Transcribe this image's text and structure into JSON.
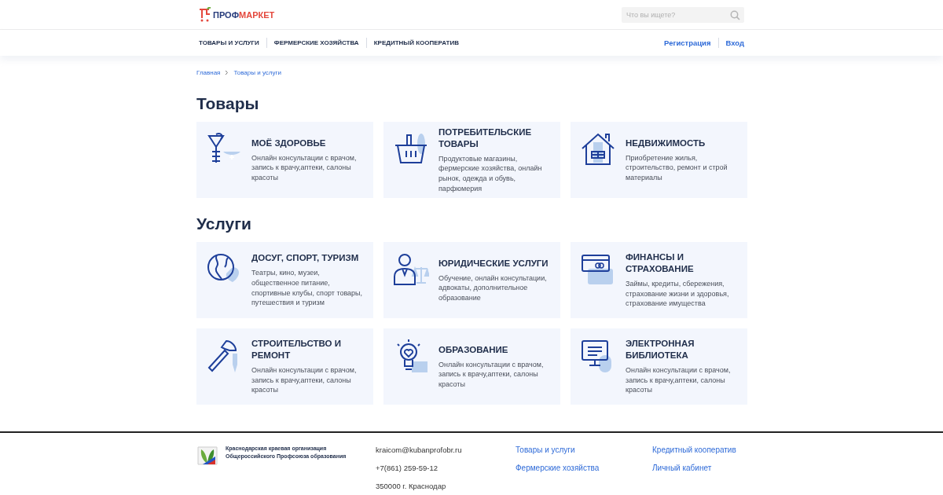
{
  "header": {
    "logo": {
      "part_1": "ПРОФ",
      "part_2": "МАРКЕТ"
    },
    "search": {
      "placeholder": "Что вы ищете?"
    }
  },
  "nav": {
    "items": [
      "ТОВАРЫ И УСЛУГИ",
      "ФЕРМЕРСКИЕ ХОЗЯЙСТВА",
      "КРЕДИТНЫЙ КООПЕРАТИВ"
    ],
    "auth": [
      "Регистрация",
      "Вход"
    ]
  },
  "breadcrumbs": [
    "Главная",
    "Товары и услуги"
  ],
  "sections": [
    {
      "title": "Товары",
      "cards": [
        {
          "title": "МОЁ ЗДОРОВЬЕ",
          "text": "Онлайн консультации с врачом, запись к врачу,аптеки, салоны красоты"
        },
        {
          "title": "ПОТРЕБИТЕЛЬСКИЕ ТОВАРЫ",
          "text": "Продуктовые магазины, фермерские хозяйства, онлайн рынок, одежда и обувь, парфюмерия"
        },
        {
          "title": "НЕДВИЖИМОСТЬ",
          "text": "Приобретение жилья, строительство, ремонт и строй материалы"
        }
      ]
    },
    {
      "title": "Услуги",
      "cards": [
        {
          "title": "ДОСУГ, СПОРТ, ТУРИЗМ",
          "text": "Театры, кино, музеи, общественное питание, спортивные клубы, спорт товары, путешествия и туризм"
        },
        {
          "title": "ЮРИДИЧЕСКИЕ УСЛУГИ",
          "text": "Обучение, онлайн консультации, адвокаты, дополнительное образование"
        },
        {
          "title": "ФИНАНСЫ И СТРАХОВАНИЕ",
          "text": "Займы, кредиты, сбережения, страхование жизни и здоровья, страхование имущества"
        },
        {
          "title": "СТРОИТЕЛЬСТВО И РЕМОНТ",
          "text": "Онлайн консультации с врачом, запись к врачу,аптеки, салоны красоты"
        },
        {
          "title": "ОБРАЗОВАНИЕ",
          "text": "Онлайн консультации с врачом, запись к врачу,аптеки, салоны красоты"
        },
        {
          "title": "ЭЛЕКТРОННАЯ БИБЛИОТЕКА",
          "text": "Онлайн консультации с врачом, запись к врачу,аптеки, салоны красоты"
        }
      ]
    }
  ],
  "footer": {
    "org": [
      "Краснодарская краевая организация",
      "Общероссийского Профсоюза образования"
    ],
    "contacts": [
      "kraicom@kubanprofobr.ru",
      "+7(861) 259-59-12",
      "350000 г. Краснодар"
    ],
    "links_1": [
      "Товары и услуги",
      "Фермерские хозяйства"
    ],
    "links_2": [
      "Кредитный кооператив",
      "Личный кабинет"
    ]
  }
}
